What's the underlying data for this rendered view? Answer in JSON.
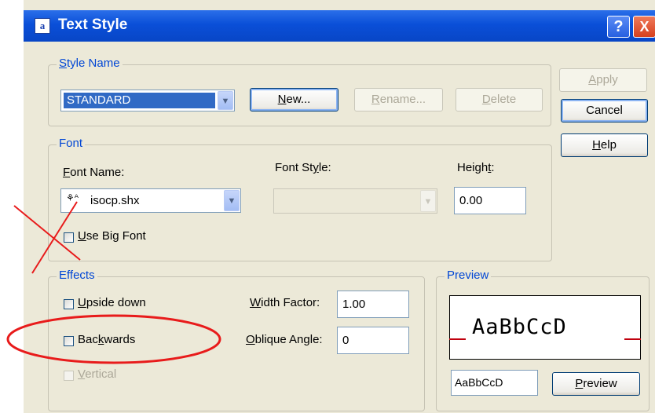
{
  "window": {
    "title": "Text Style"
  },
  "title_buttons": {
    "help": "?",
    "close": "X"
  },
  "style_name": {
    "legend": "Style Name",
    "selected": "STANDARD",
    "new_label": "New...",
    "rename_label": "Rename...",
    "delete_label": "Delete"
  },
  "side_buttons": {
    "apply": "Apply",
    "cancel": "Cancel",
    "help": "Help"
  },
  "font": {
    "legend": "Font",
    "font_name_label": "Font Name:",
    "font_name_value": "isocp.shx",
    "font_style_label": "Font Style:",
    "font_style_value": "",
    "height_label": "Height:",
    "height_value": "0.00",
    "big_font_label": "Use Big Font"
  },
  "effects": {
    "legend": "Effects",
    "upside_down": "Upside down",
    "backwards": "Backwards",
    "vertical": "Vertical",
    "width_factor_label": "Width Factor:",
    "width_factor_value": "1.00",
    "oblique_angle_label": "Oblique Angle:",
    "oblique_angle_value": "0"
  },
  "preview": {
    "legend": "Preview",
    "sample_display": "AaBbCcD",
    "sample_input": "AaBbCcD",
    "button": "Preview"
  },
  "annotations": {
    "cross_color": "#e81b1b",
    "ellipse_color": "#e81b1b"
  }
}
